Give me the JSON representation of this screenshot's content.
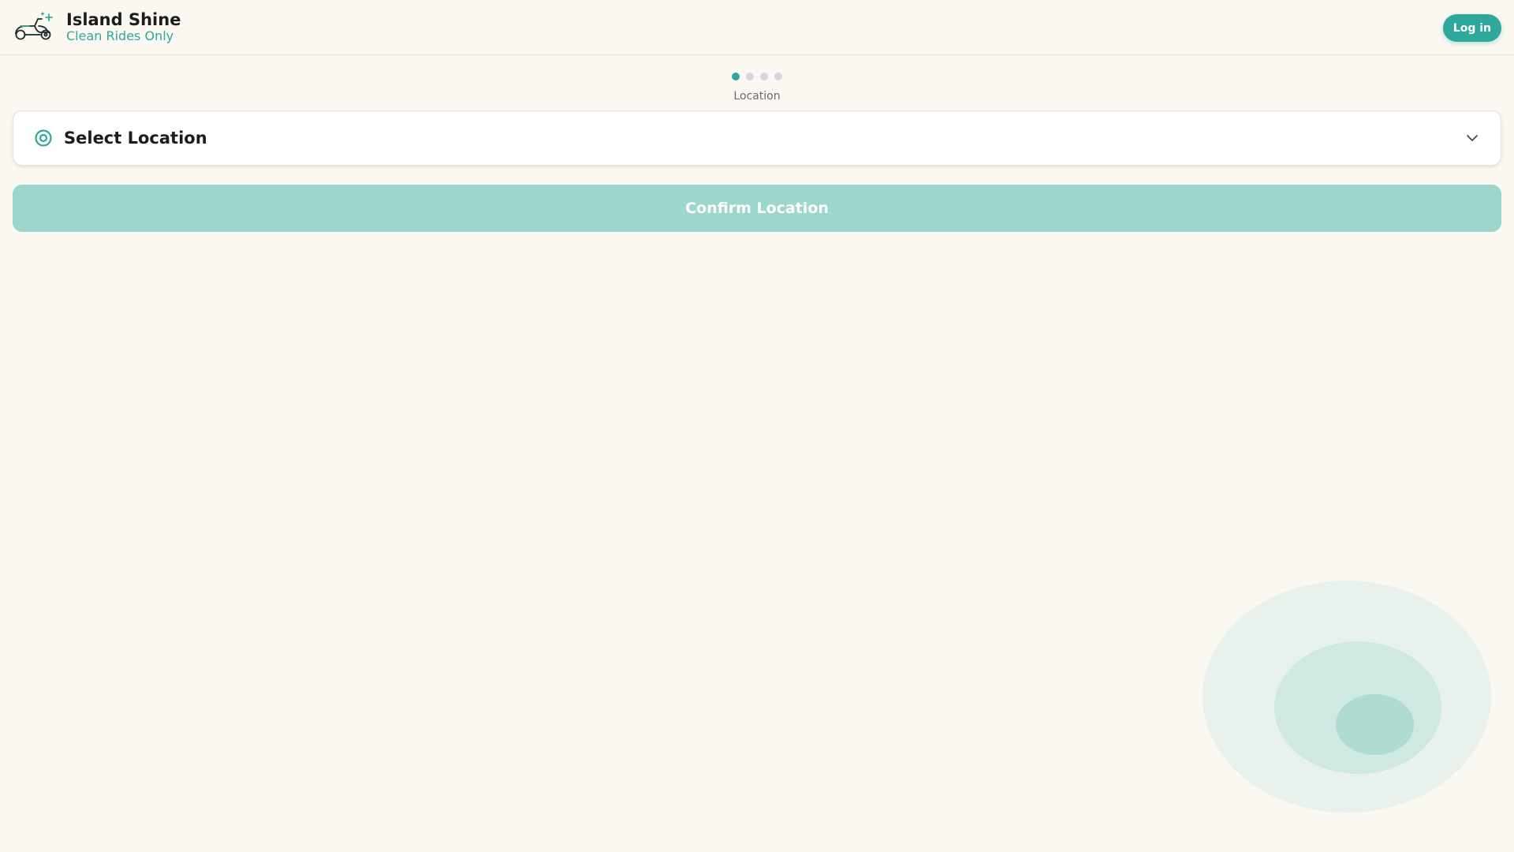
{
  "header": {
    "brand_title": "Island Shine",
    "brand_tagline": "Clean Rides Only",
    "logo_icon": "scooter-sparkle-icon",
    "login_label": "Log in"
  },
  "stepper": {
    "total_steps": 4,
    "current_step": 1,
    "current_label": "Location"
  },
  "location_card": {
    "title": "Select Location",
    "icon": "location-target-icon",
    "toggle_icon": "chevron-down-icon"
  },
  "confirm_button": {
    "label": "Confirm Location",
    "enabled": false
  },
  "colors": {
    "accent": "#2fa89b",
    "accent_disabled": "#9dd6cc",
    "background": "#fbf8f2",
    "dot_inactive": "#d3d5df"
  }
}
